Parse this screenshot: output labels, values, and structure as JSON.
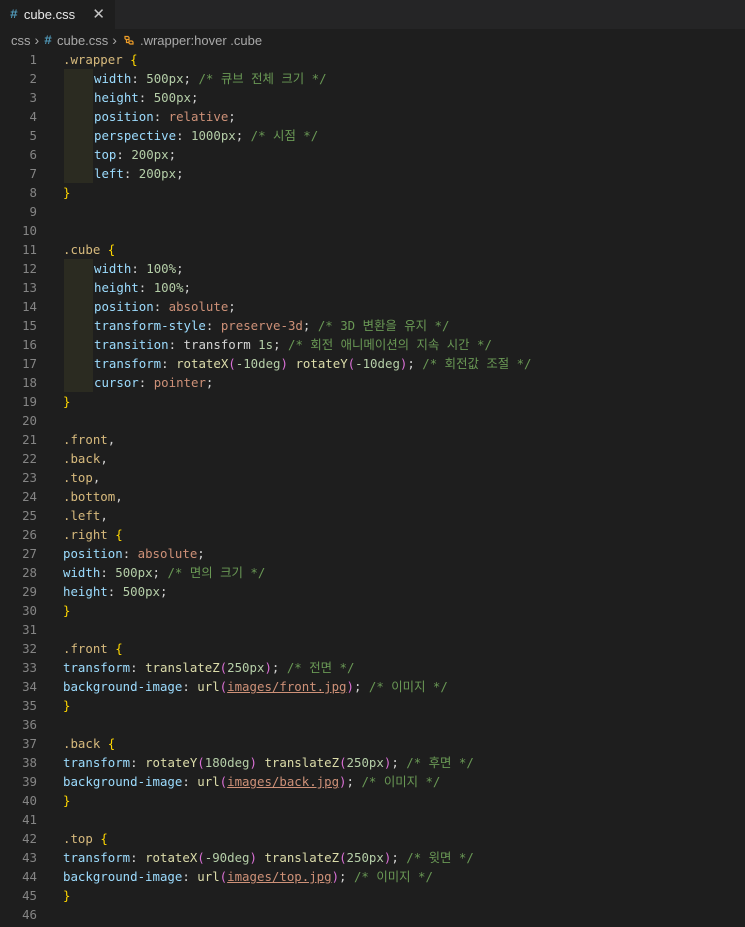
{
  "tab": {
    "icon": "#",
    "label": "cube.css",
    "close": "✕"
  },
  "breadcrumb": {
    "folder": "css",
    "file_icon": "#",
    "file": "cube.css",
    "symbol": ".wrapper:hover .cube"
  },
  "editor": {
    "lines": [
      {
        "n": "1",
        "indent": false,
        "tokens": [
          [
            "selector",
            ".wrapper"
          ],
          [
            "punct",
            " "
          ],
          [
            "brace",
            "{"
          ]
        ]
      },
      {
        "n": "2",
        "indent": true,
        "tokens": [
          [
            "prop",
            "width"
          ],
          [
            "punct",
            ": "
          ],
          [
            "num",
            "500px"
          ],
          [
            "punct",
            "; "
          ],
          [
            "comment",
            "/* 큐브 전체 크기 */"
          ]
        ]
      },
      {
        "n": "3",
        "indent": true,
        "tokens": [
          [
            "prop",
            "height"
          ],
          [
            "punct",
            ": "
          ],
          [
            "num",
            "500px"
          ],
          [
            "punct",
            ";"
          ]
        ]
      },
      {
        "n": "4",
        "indent": true,
        "tokens": [
          [
            "prop",
            "position"
          ],
          [
            "punct",
            ": "
          ],
          [
            "val",
            "relative"
          ],
          [
            "punct",
            ";"
          ]
        ]
      },
      {
        "n": "5",
        "indent": true,
        "tokens": [
          [
            "prop",
            "perspective"
          ],
          [
            "punct",
            ": "
          ],
          [
            "num",
            "1000px"
          ],
          [
            "punct",
            "; "
          ],
          [
            "comment",
            "/* 시점 */"
          ]
        ]
      },
      {
        "n": "6",
        "indent": true,
        "tokens": [
          [
            "prop",
            "top"
          ],
          [
            "punct",
            ": "
          ],
          [
            "num",
            "200px"
          ],
          [
            "punct",
            ";"
          ]
        ]
      },
      {
        "n": "7",
        "indent": true,
        "tokens": [
          [
            "prop",
            "left"
          ],
          [
            "punct",
            ": "
          ],
          [
            "num",
            "200px"
          ],
          [
            "punct",
            ";"
          ]
        ]
      },
      {
        "n": "8",
        "indent": false,
        "tokens": [
          [
            "brace",
            "}"
          ]
        ]
      },
      {
        "n": "9",
        "indent": false,
        "tokens": []
      },
      {
        "n": "10",
        "indent": false,
        "tokens": []
      },
      {
        "n": "11",
        "indent": false,
        "tokens": [
          [
            "selector",
            ".cube"
          ],
          [
            "punct",
            " "
          ],
          [
            "brace",
            "{"
          ]
        ]
      },
      {
        "n": "12",
        "indent": true,
        "tokens": [
          [
            "prop",
            "width"
          ],
          [
            "punct",
            ": "
          ],
          [
            "num",
            "100%"
          ],
          [
            "punct",
            ";"
          ]
        ]
      },
      {
        "n": "13",
        "indent": true,
        "tokens": [
          [
            "prop",
            "height"
          ],
          [
            "punct",
            ": "
          ],
          [
            "num",
            "100%"
          ],
          [
            "punct",
            ";"
          ]
        ]
      },
      {
        "n": "14",
        "indent": true,
        "tokens": [
          [
            "prop",
            "position"
          ],
          [
            "punct",
            ": "
          ],
          [
            "val",
            "absolute"
          ],
          [
            "punct",
            ";"
          ]
        ]
      },
      {
        "n": "15",
        "indent": true,
        "tokens": [
          [
            "prop",
            "transform-style"
          ],
          [
            "punct",
            ": "
          ],
          [
            "val",
            "preserve-3d"
          ],
          [
            "punct",
            "; "
          ],
          [
            "comment",
            "/* 3D 변환을 유지 */"
          ]
        ]
      },
      {
        "n": "16",
        "indent": true,
        "tokens": [
          [
            "prop",
            "transition"
          ],
          [
            "punct",
            ": "
          ],
          [
            "punct",
            "transform "
          ],
          [
            "num",
            "1s"
          ],
          [
            "punct",
            "; "
          ],
          [
            "comment",
            "/* 회전 애니메이션의 지속 시간 */"
          ]
        ]
      },
      {
        "n": "17",
        "indent": true,
        "tokens": [
          [
            "prop",
            "transform"
          ],
          [
            "punct",
            ": "
          ],
          [
            "func",
            "rotateX"
          ],
          [
            "paren",
            "("
          ],
          [
            "num",
            "-10deg"
          ],
          [
            "paren",
            ")"
          ],
          [
            "punct",
            " "
          ],
          [
            "func",
            "rotateY"
          ],
          [
            "paren",
            "("
          ],
          [
            "num",
            "-10deg"
          ],
          [
            "paren",
            ")"
          ],
          [
            "punct",
            "; "
          ],
          [
            "comment",
            "/* 회전값 조절 */"
          ]
        ]
      },
      {
        "n": "18",
        "indent": true,
        "tokens": [
          [
            "prop",
            "cursor"
          ],
          [
            "punct",
            ": "
          ],
          [
            "val",
            "pointer"
          ],
          [
            "punct",
            ";"
          ]
        ]
      },
      {
        "n": "19",
        "indent": false,
        "tokens": [
          [
            "brace",
            "}"
          ]
        ]
      },
      {
        "n": "20",
        "indent": false,
        "tokens": []
      },
      {
        "n": "21",
        "indent": false,
        "tokens": [
          [
            "selector",
            ".front"
          ],
          [
            "punct",
            ","
          ]
        ]
      },
      {
        "n": "22",
        "indent": false,
        "tokens": [
          [
            "selector",
            ".back"
          ],
          [
            "punct",
            ","
          ]
        ]
      },
      {
        "n": "23",
        "indent": false,
        "tokens": [
          [
            "selector",
            ".top"
          ],
          [
            "punct",
            ","
          ]
        ]
      },
      {
        "n": "24",
        "indent": false,
        "tokens": [
          [
            "selector",
            ".bottom"
          ],
          [
            "punct",
            ","
          ]
        ]
      },
      {
        "n": "25",
        "indent": false,
        "tokens": [
          [
            "selector",
            ".left"
          ],
          [
            "punct",
            ","
          ]
        ]
      },
      {
        "n": "26",
        "indent": false,
        "tokens": [
          [
            "selector",
            ".right"
          ],
          [
            "punct",
            " "
          ],
          [
            "brace",
            "{"
          ]
        ]
      },
      {
        "n": "27",
        "indent": false,
        "tokens": [
          [
            "prop",
            "position"
          ],
          [
            "punct",
            ": "
          ],
          [
            "val",
            "absolute"
          ],
          [
            "punct",
            ";"
          ]
        ]
      },
      {
        "n": "28",
        "indent": false,
        "tokens": [
          [
            "prop",
            "width"
          ],
          [
            "punct",
            ": "
          ],
          [
            "num",
            "500px"
          ],
          [
            "punct",
            "; "
          ],
          [
            "comment",
            "/* 면의 크기 */"
          ]
        ]
      },
      {
        "n": "29",
        "indent": false,
        "tokens": [
          [
            "prop",
            "height"
          ],
          [
            "punct",
            ": "
          ],
          [
            "num",
            "500px"
          ],
          [
            "punct",
            ";"
          ]
        ]
      },
      {
        "n": "30",
        "indent": false,
        "tokens": [
          [
            "brace",
            "}"
          ]
        ]
      },
      {
        "n": "31",
        "indent": false,
        "tokens": []
      },
      {
        "n": "32",
        "indent": false,
        "tokens": [
          [
            "selector",
            ".front"
          ],
          [
            "punct",
            " "
          ],
          [
            "brace",
            "{"
          ]
        ]
      },
      {
        "n": "33",
        "indent": false,
        "tokens": [
          [
            "prop",
            "transform"
          ],
          [
            "punct",
            ": "
          ],
          [
            "func",
            "translateZ"
          ],
          [
            "paren",
            "("
          ],
          [
            "num",
            "250px"
          ],
          [
            "paren",
            ")"
          ],
          [
            "punct",
            "; "
          ],
          [
            "comment",
            "/* 전면 */"
          ]
        ]
      },
      {
        "n": "34",
        "indent": false,
        "tokens": [
          [
            "prop",
            "background-image"
          ],
          [
            "punct",
            ": "
          ],
          [
            "func",
            "url"
          ],
          [
            "paren",
            "("
          ],
          [
            "url",
            "images/front.jpg"
          ],
          [
            "paren",
            ")"
          ],
          [
            "punct",
            "; "
          ],
          [
            "comment",
            "/* 이미지 */"
          ]
        ]
      },
      {
        "n": "35",
        "indent": false,
        "tokens": [
          [
            "brace",
            "}"
          ]
        ]
      },
      {
        "n": "36",
        "indent": false,
        "tokens": []
      },
      {
        "n": "37",
        "indent": false,
        "tokens": [
          [
            "selector",
            ".back"
          ],
          [
            "punct",
            " "
          ],
          [
            "brace",
            "{"
          ]
        ]
      },
      {
        "n": "38",
        "indent": false,
        "tokens": [
          [
            "prop",
            "transform"
          ],
          [
            "punct",
            ": "
          ],
          [
            "func",
            "rotateY"
          ],
          [
            "paren",
            "("
          ],
          [
            "num",
            "180deg"
          ],
          [
            "paren",
            ")"
          ],
          [
            "punct",
            " "
          ],
          [
            "func",
            "translateZ"
          ],
          [
            "paren",
            "("
          ],
          [
            "num",
            "250px"
          ],
          [
            "paren",
            ")"
          ],
          [
            "punct",
            "; "
          ],
          [
            "comment",
            "/* 후면 */"
          ]
        ]
      },
      {
        "n": "39",
        "indent": false,
        "tokens": [
          [
            "prop",
            "background-image"
          ],
          [
            "punct",
            ": "
          ],
          [
            "func",
            "url"
          ],
          [
            "paren",
            "("
          ],
          [
            "url",
            "images/back.jpg"
          ],
          [
            "paren",
            ")"
          ],
          [
            "punct",
            "; "
          ],
          [
            "comment",
            "/* 이미지 */"
          ]
        ]
      },
      {
        "n": "40",
        "indent": false,
        "tokens": [
          [
            "brace",
            "}"
          ]
        ]
      },
      {
        "n": "41",
        "indent": false,
        "tokens": []
      },
      {
        "n": "42",
        "indent": false,
        "tokens": [
          [
            "selector",
            ".top"
          ],
          [
            "punct",
            " "
          ],
          [
            "brace",
            "{"
          ]
        ]
      },
      {
        "n": "43",
        "indent": false,
        "tokens": [
          [
            "prop",
            "transform"
          ],
          [
            "punct",
            ": "
          ],
          [
            "func",
            "rotateX"
          ],
          [
            "paren",
            "("
          ],
          [
            "num",
            "-90deg"
          ],
          [
            "paren",
            ")"
          ],
          [
            "punct",
            " "
          ],
          [
            "func",
            "translateZ"
          ],
          [
            "paren",
            "("
          ],
          [
            "num",
            "250px"
          ],
          [
            "paren",
            ")"
          ],
          [
            "punct",
            "; "
          ],
          [
            "comment",
            "/* 윗면 */"
          ]
        ]
      },
      {
        "n": "44",
        "indent": false,
        "tokens": [
          [
            "prop",
            "background-image"
          ],
          [
            "punct",
            ": "
          ],
          [
            "func",
            "url"
          ],
          [
            "paren",
            "("
          ],
          [
            "url",
            "images/top.jpg"
          ],
          [
            "paren",
            ")"
          ],
          [
            "punct",
            "; "
          ],
          [
            "comment",
            "/* 이미지 */"
          ]
        ]
      },
      {
        "n": "45",
        "indent": false,
        "tokens": [
          [
            "brace",
            "}"
          ]
        ]
      },
      {
        "n": "46",
        "indent": false,
        "tokens": []
      }
    ]
  }
}
